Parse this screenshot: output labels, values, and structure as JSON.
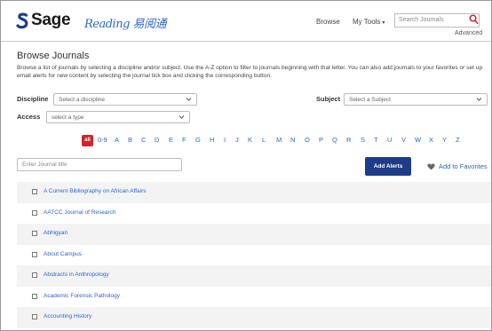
{
  "header": {
    "brand": "Sage",
    "sub_brand": "Reading 易阅通",
    "nav": {
      "browse": "Browse",
      "my_tools": "My Tools"
    },
    "search": {
      "placeholder": "Search Journals",
      "advanced": "Advanced"
    }
  },
  "main": {
    "title": "Browse Journals",
    "description": "Browse a list of journals by selecting a discipline and/or subject. Use the A-Z option to filter to journals beginning with that letter. You can also add journals to your favorites or set up email alerts for new content by selecting the journal tick box and clicking the corresponding button.",
    "filters": {
      "discipline_label": "Discipline",
      "discipline_value": "Select a discipline",
      "subject_label": "Subject",
      "subject_value": "Select a Subject",
      "access_label": "Access",
      "access_value": "select a type"
    },
    "az": [
      "all",
      "0-9",
      "A",
      "B",
      "C",
      "D",
      "E",
      "F",
      "G",
      "H",
      "I",
      "J",
      "K",
      "L",
      "M",
      "N",
      "O",
      "P",
      "Q",
      "R",
      "S",
      "T",
      "U",
      "V",
      "W",
      "X",
      "Y",
      "Z"
    ],
    "title_filter_placeholder": "Enter Journal title",
    "add_alerts": "Add Alerts",
    "add_favorites": "Add to Favorites",
    "journals": [
      "A Current Bibliography on African Affairs",
      "AATCC Journal of Research",
      "Abhigyan",
      "About Campus",
      "Abstracts in Anthropology",
      "Academic Forensic Pathology",
      "Accounting History"
    ]
  },
  "colors": {
    "accent": "#2c66c9",
    "primary_button": "#1f3c88",
    "all_badge": "#d2232a"
  },
  "icons": [
    "sage-logo-icon",
    "search-icon",
    "chevron-down-icon",
    "heart-icon",
    "checkbox-icon"
  ]
}
